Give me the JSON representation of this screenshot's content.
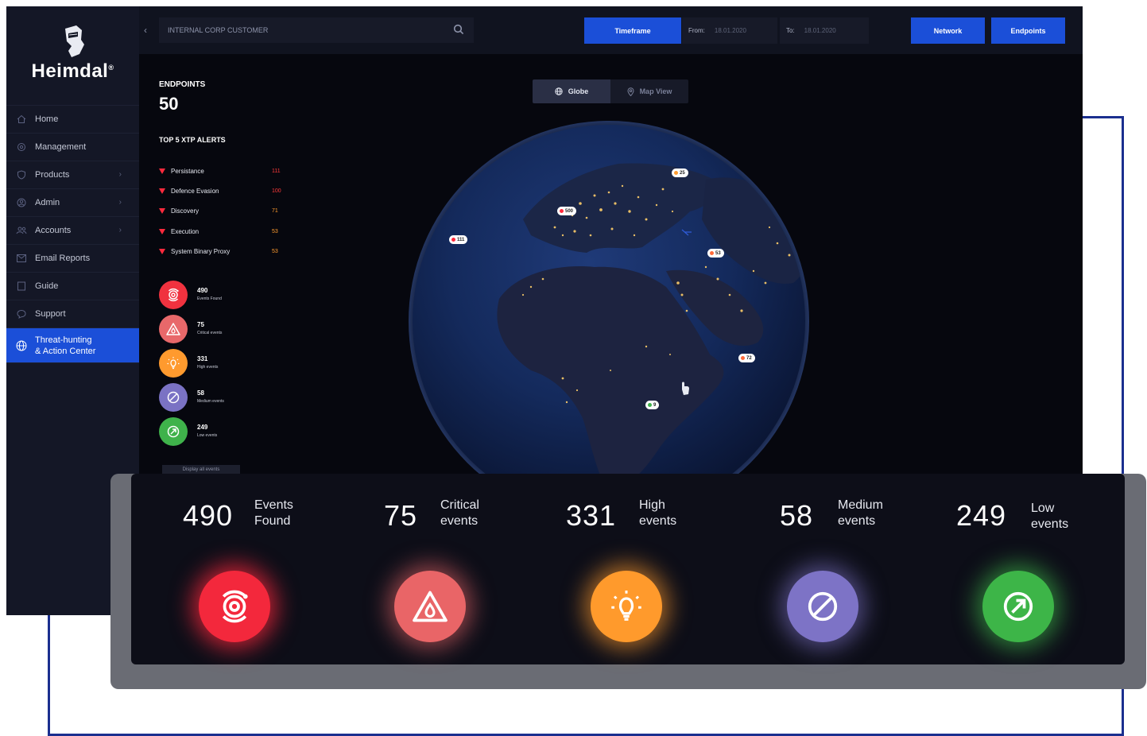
{
  "brand": {
    "name": "Heimdal",
    "mark": "®"
  },
  "sidebar": {
    "items": [
      {
        "label": "Home",
        "icon": "home-icon"
      },
      {
        "label": "Management",
        "icon": "gear-icon"
      },
      {
        "label": "Products",
        "icon": "shield-icon",
        "chevron": "›"
      },
      {
        "label": "Admin",
        "icon": "user-circle-icon",
        "chevron": "›"
      },
      {
        "label": "Accounts",
        "icon": "users-icon",
        "chevron": "›"
      },
      {
        "label": "Email Reports",
        "icon": "mail-icon"
      },
      {
        "label": "Guide",
        "icon": "book-icon"
      },
      {
        "label": "Support",
        "icon": "chat-icon"
      }
    ],
    "active": {
      "line1": "Threat-hunting",
      "line2": "& Action Center",
      "icon": "globe-icon"
    }
  },
  "topbar": {
    "collapse": "‹",
    "search_value": "INTERNAL CORP CUSTOMER",
    "timeframe_label": "Timeframe",
    "from_label": "From:",
    "from_value": "18.01.2020",
    "to_label": "To:",
    "to_value": "18.01.2020",
    "network_label": "Network",
    "endpoints_label": "Endpoints"
  },
  "endpoints": {
    "label": "ENDPOINTS",
    "value": "50"
  },
  "xtp": {
    "title": "TOP 5 XTP ALERTS",
    "alerts": [
      {
        "name": "Persistance",
        "count": "111",
        "color": "#ff3a3a"
      },
      {
        "name": "Defence Evasion",
        "count": "100",
        "color": "#ff3a3a"
      },
      {
        "name": "Discovery",
        "count": "71",
        "color": "#ff9b2f"
      },
      {
        "name": "Execution",
        "count": "53",
        "color": "#ff9b2f"
      },
      {
        "name": "System Binary Proxy",
        "count": "53",
        "color": "#ff9b2f"
      }
    ]
  },
  "events_small": [
    {
      "num": "490",
      "label": "Events Found",
      "color": "#f0323f",
      "icon": "radar-icon"
    },
    {
      "num": "75",
      "label": "Critical events",
      "color": "#e8686a",
      "icon": "warning-icon"
    },
    {
      "num": "331",
      "label": "High events",
      "color": "#ff9a2e",
      "icon": "bulb-icon"
    },
    {
      "num": "58",
      "label": "Medium events",
      "color": "#7a72c4",
      "icon": "block-icon"
    },
    {
      "num": "249",
      "label": "Low events",
      "color": "#3fb24b",
      "icon": "arrow-circle-icon"
    }
  ],
  "display_all": "Display all events",
  "view_toggle": {
    "globe": "Globe",
    "map": "Map View"
  },
  "markers": [
    {
      "count": "25",
      "color": "#ff9b2f"
    },
    {
      "count": "500",
      "color": "#ff2a3d"
    },
    {
      "count": "111",
      "color": "#ff2a3d"
    },
    {
      "count": "53",
      "color": "#ff6a3a"
    },
    {
      "count": "72",
      "color": "#ff6a3a"
    },
    {
      "count": "9",
      "color": "#3fb24b"
    }
  ],
  "stats": [
    {
      "num": "490",
      "line1": "Events",
      "line2": "Found",
      "color": "#f3283c",
      "glow": "rgba(255,40,60,0.75)",
      "icon": "radar-icon"
    },
    {
      "num": "75",
      "line1": "Critical",
      "line2": "events",
      "color": "#e96567",
      "glow": "rgba(233,101,103,0.6)",
      "icon": "warning-icon"
    },
    {
      "num": "331",
      "line1": "High",
      "line2": "events",
      "color": "#ff9a2c",
      "glow": "rgba(255,154,44,0.65)",
      "icon": "bulb-icon"
    },
    {
      "num": "58",
      "line1": "Medium",
      "line2": "events",
      "color": "#7d73c6",
      "glow": "rgba(125,115,198,0.6)",
      "icon": "block-icon"
    },
    {
      "num": "249",
      "line1": "Low",
      "line2": "events",
      "color": "#3db548",
      "glow": "rgba(61,181,72,0.65)",
      "icon": "arrow-circle-icon"
    }
  ]
}
